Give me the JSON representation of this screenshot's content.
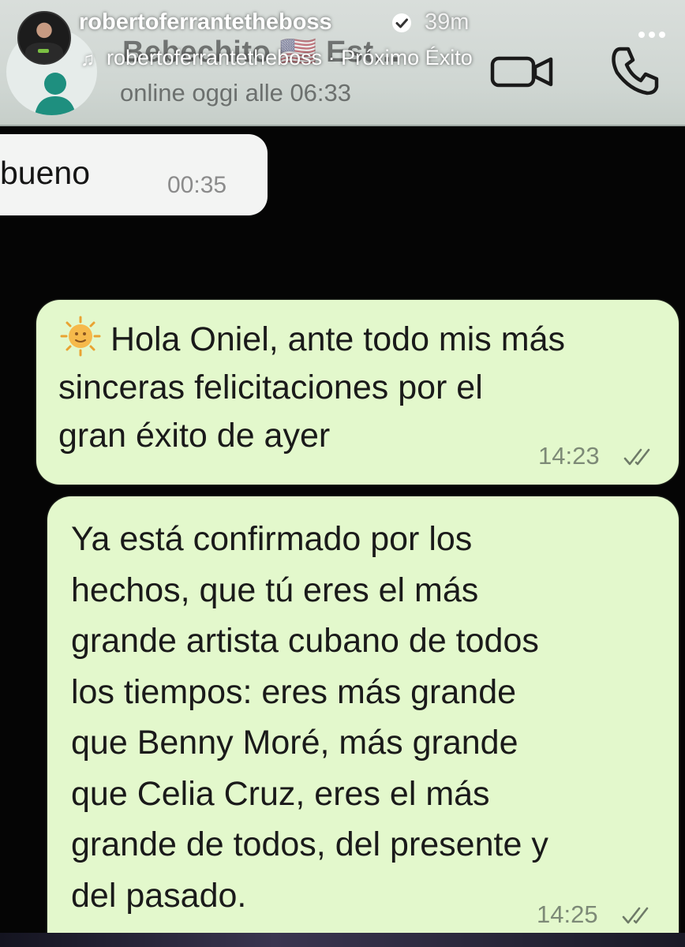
{
  "story": {
    "username": "robertoferrantetheboss",
    "time_ago": "39m",
    "music_line": "robertoferrantetheboss · Próximo Éxito"
  },
  "chat_header": {
    "contact_name": "Bebechito 🇺🇸 Est...",
    "status": "online oggi alle 06:33"
  },
  "messages": [
    {
      "direction": "in",
      "text": "bueno",
      "time": "00:35"
    },
    {
      "direction": "out",
      "text": "Hola Oniel, ante todo mis más\nsinceras felicitaciones por el\ngran éxito de ayer",
      "time": "14:23"
    },
    {
      "direction": "out",
      "text": "Ya está confirmado por los\nhechos, que tú eres el más\ngrande artista cubano de todos\nlos tiempos: eres más grande\nque Benny Moré, más grande\nque Celia Cruz, eres el más\ngrande de todos, del presente y\ndel pasado.",
      "time": "14:25"
    }
  ],
  "colors": {
    "outgoing_bubble": "#e3f8cc",
    "incoming_bubble": "#f3f4f3",
    "chat_background": "#050505",
    "header_background": "#d3d9d6"
  },
  "icons": [
    "contact-avatar-icon",
    "video-call-icon",
    "phone-icon",
    "verified-icon",
    "more-icon",
    "music-note-icon",
    "sun-emoji-icon",
    "double-check-icon"
  ]
}
